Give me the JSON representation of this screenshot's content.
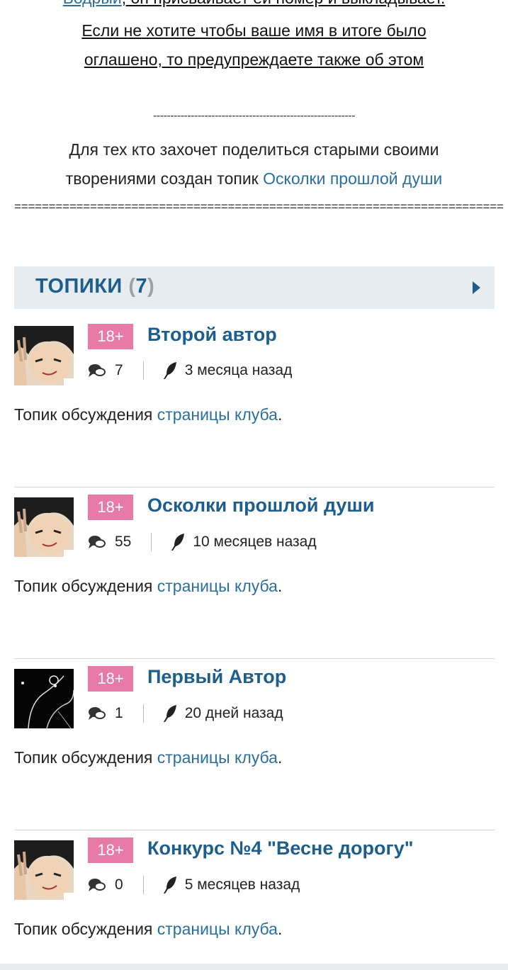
{
  "intro": {
    "line0_link": "Бодрый",
    "line0_rest": ", он присваивает ей номер и выкладывает.",
    "line1": "Если не хотите чтобы ваше имя в итоге было",
    "line2": "оглашено, то предупреждаете также об этом",
    "dashes": "-----------------------------------------------------------",
    "line4": "Для тех кто захочет поделиться старыми своими",
    "line5_text": "творениями создан топик ",
    "line5_link": "Осколки прошлой души",
    "equals": "======================================================================="
  },
  "section": {
    "title": "ТОПИКИ",
    "count_open": "(",
    "count": "7",
    "count_close": ")"
  },
  "topics": [
    {
      "badge": "18+",
      "title": "Второй автор",
      "comments": "7",
      "time": "3 месяца назад",
      "desc_text": "Топик обсуждения ",
      "desc_link": "страницы клуба",
      "desc_end": ".",
      "avatar": "anime-boy-avatar"
    },
    {
      "badge": "18+",
      "title": "Осколки прошлой души",
      "comments": "55",
      "time": "10 месяцев назад",
      "desc_text": "Топик обсуждения ",
      "desc_link": "страницы клуба",
      "desc_end": ".",
      "avatar": "anime-boy-avatar"
    },
    {
      "badge": "18+",
      "title": "Первый Автор",
      "comments": "1",
      "time": "20 дней назад",
      "desc_text": "Топик обсуждения ",
      "desc_link": "страницы клуба",
      "desc_end": ".",
      "avatar": "dark-sketch-avatar"
    },
    {
      "badge": "18+",
      "title": "Конкурс №4 \"Весне дорогу\"",
      "comments": "0",
      "time": "5 месяцев назад",
      "desc_text": "Топик обсуждения ",
      "desc_link": "страницы клуба",
      "desc_end": ".",
      "avatar": "anime-boy-avatar"
    }
  ],
  "colors": {
    "accent": "#1d5e8c",
    "link": "#2b6f9e",
    "badge": "#e87aa8",
    "header_bg": "#e7ecf0"
  }
}
